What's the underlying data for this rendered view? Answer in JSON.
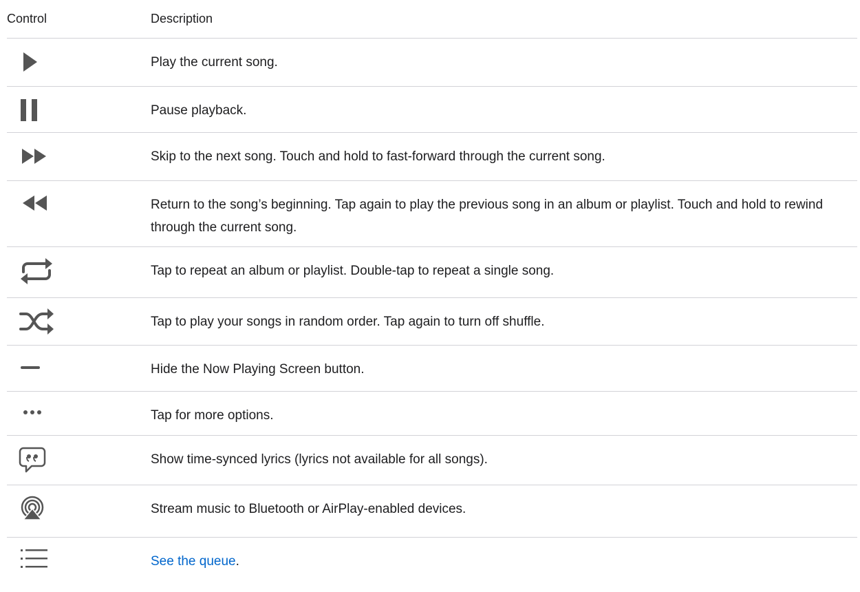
{
  "header": {
    "control": "Control",
    "description": "Description"
  },
  "rows": [
    {
      "icon": "play-icon",
      "description": "Play the current song."
    },
    {
      "icon": "pause-icon",
      "description": "Pause playback."
    },
    {
      "icon": "fast-forward-icon",
      "description": "Skip to the next song. Touch and hold to fast-forward through the current song."
    },
    {
      "icon": "rewind-icon",
      "description": "Return to the song’s beginning. Tap again to play the previous song in an album or playlist. Touch and hold to rewind through the current song."
    },
    {
      "icon": "repeat-icon",
      "description": "Tap to repeat an album or playlist. Double-tap to repeat a single song."
    },
    {
      "icon": "shuffle-icon",
      "description": "Tap to play your songs in random order. Tap again to turn off shuffle."
    },
    {
      "icon": "minus-icon",
      "description": "Hide the Now Playing Screen button."
    },
    {
      "icon": "ellipsis-icon",
      "description": "Tap for more options."
    },
    {
      "icon": "lyrics-icon",
      "description": "Show time-synced lyrics (lyrics not available for all songs)."
    },
    {
      "icon": "airplay-icon",
      "description": "Stream music to Bluetooth or AirPlay-enabled devices."
    },
    {
      "icon": "queue-list-icon",
      "link_text": "See the queue",
      "suffix": "."
    }
  ],
  "colors": {
    "icon": "#555555",
    "link": "#0066cc",
    "divider": "#d2d2d7"
  }
}
